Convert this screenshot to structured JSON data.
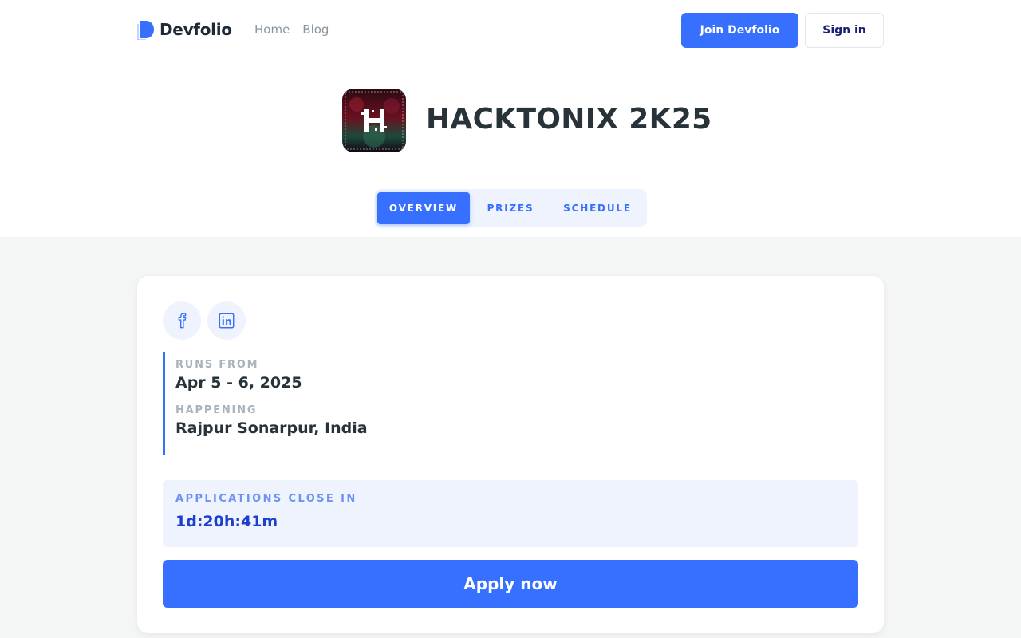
{
  "brand": {
    "name": "Devfolio",
    "accent": "#3770ff"
  },
  "nav": {
    "links": [
      "Home",
      "Blog"
    ],
    "join_label": "Join Devfolio",
    "signin_label": "Sign in"
  },
  "event": {
    "title": "HACKTONIX 2K25"
  },
  "tabs": [
    {
      "label": "OVERVIEW",
      "active": true
    },
    {
      "label": "PRIZES",
      "active": false
    },
    {
      "label": "SCHEDULE",
      "active": false
    }
  ],
  "social": {
    "icons": [
      "facebook-icon",
      "linkedin-icon"
    ]
  },
  "details": {
    "runs_from_label": "RUNS FROM",
    "runs_from_value": "Apr 5 - 6, 2025",
    "happening_label": "HAPPENING",
    "happening_value": "Rajpur Sonarpur, India"
  },
  "countdown": {
    "label": "APPLICATIONS CLOSE IN",
    "value": "1d:20h:41m"
  },
  "apply": {
    "label": "Apply now"
  }
}
